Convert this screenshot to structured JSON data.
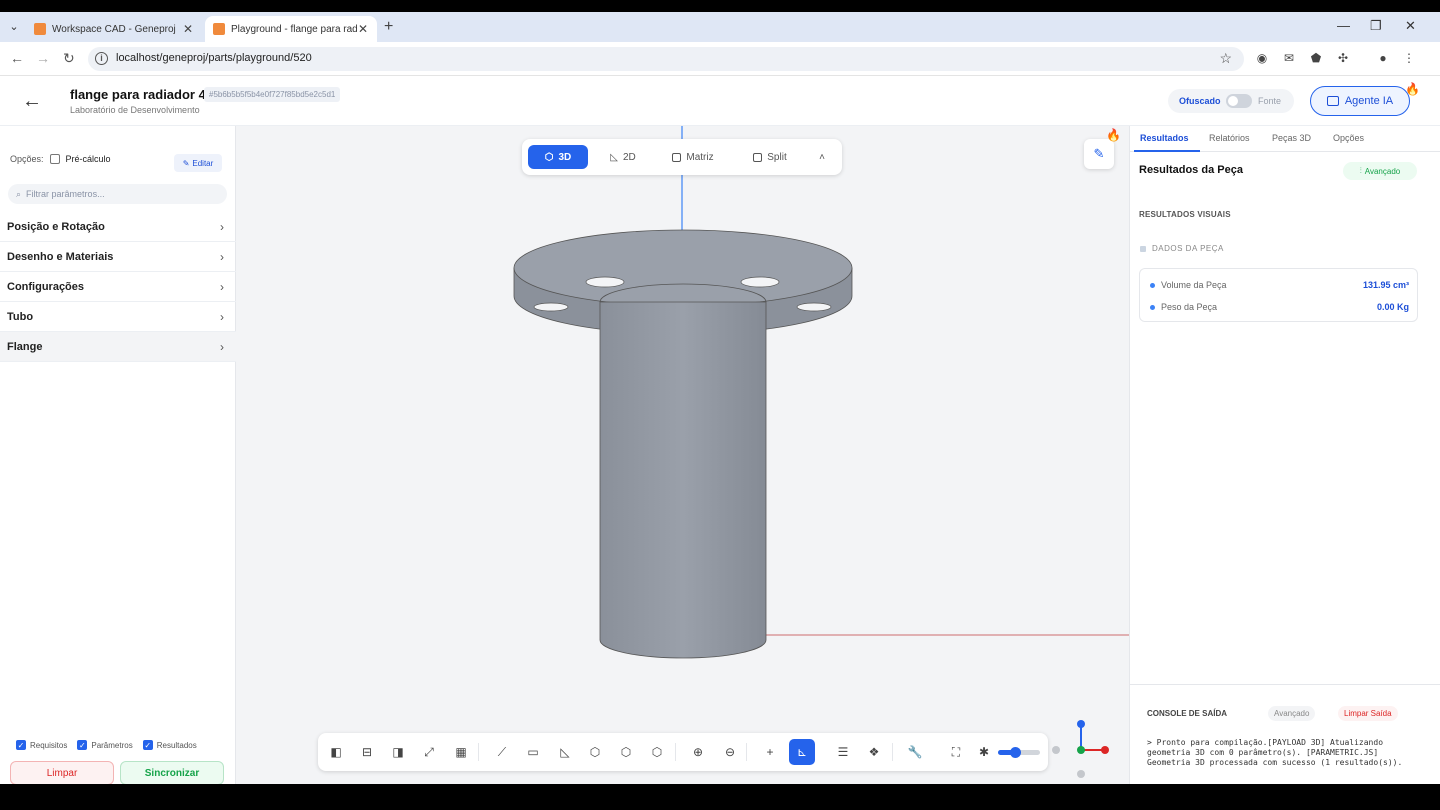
{
  "browser": {
    "tabs": [
      {
        "title": "Workspace CAD - Geneproj"
      },
      {
        "title": "Playground - flange para radia"
      }
    ],
    "url": "localhost/geneproj/parts/playground/520"
  },
  "header": {
    "title": "flange para radiador 4",
    "hash": "#5b6b5b5f5b4e0f727f85bd5e2c5d1",
    "subtitle": "Laboratório de Desenvolvimento",
    "toggle_left": "Ofuscado",
    "toggle_right": "Fonte",
    "agent_button": "Agente IA"
  },
  "left": {
    "options_label": "Opções:",
    "precalc_label": "Pré-cálculo",
    "edit_label": "Editar",
    "filter_placeholder": "Filtrar parâmetros...",
    "sections": [
      "Posição e Rotação",
      "Desenho e Materiais",
      "Configurações",
      "Tubo",
      "Flange"
    ],
    "checks": [
      "Requisitos",
      "Parâmetros",
      "Resultados"
    ],
    "clear_button": "Limpar",
    "sync_button": "Sincronizar"
  },
  "viewport": {
    "modes": [
      "3D",
      "2D",
      "Matriz",
      "Split"
    ],
    "active_mode": "3D",
    "zoom_slider_level": 0.4
  },
  "right": {
    "tabs": [
      "Resultados",
      "Relatórios",
      "Peças 3D",
      "Opções"
    ],
    "title": "Resultados da Peça",
    "advanced_badge": "Avançado",
    "visual_results": "RESULTADOS VISUAIS",
    "part_data": "DADOS DA PEÇA",
    "rows": [
      {
        "label": "Volume da Peça",
        "value": "131.95 cm³"
      },
      {
        "label": "Peso da Peça",
        "value": "0.00 Kg"
      }
    ],
    "console_title": "CONSOLE DE SAÍDA",
    "console_advanced": "Avançado",
    "console_clear": "Limpar Saída",
    "console_text": "> Pronto para compilação.[PAYLOAD 3D] Atualizando geometria 3D com 0 parâmetro(s). [PARAMETRIC.JS] Geometria 3D processada com sucesso (1 resultado(s))."
  }
}
